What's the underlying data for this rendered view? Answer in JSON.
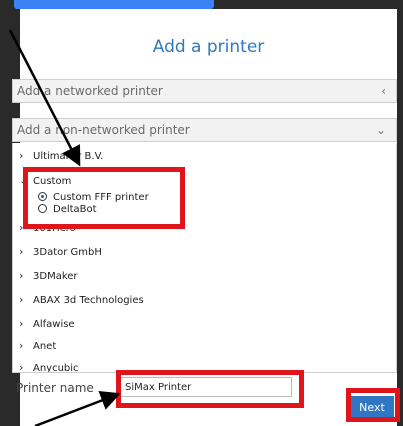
{
  "dialog": {
    "title": "Add a printer",
    "networked_label": "Add a networked printer",
    "nonnetworked_label": "Add a non-networked printer"
  },
  "icons": {
    "networked_chevron": "chevron-left-icon",
    "nonnetworked_chevron": "chevron-down-icon",
    "expand_arrow": "chevron-right-icon"
  },
  "manufacturers": [
    {
      "label": "Ultimaker B.V.",
      "expanded": false
    },
    {
      "label": "Custom",
      "expanded": true
    },
    {
      "label": "101Hero",
      "expanded": false
    },
    {
      "label": "3Dator GmbH",
      "expanded": false
    },
    {
      "label": "3DMaker",
      "expanded": false
    },
    {
      "label": "ABAX 3d Technologies",
      "expanded": false
    },
    {
      "label": "Alfawise",
      "expanded": false
    },
    {
      "label": "Anet",
      "expanded": false
    },
    {
      "label": "Anycubic",
      "expanded": false
    }
  ],
  "custom_printers": [
    {
      "label": "Custom FFF printer",
      "selected": true
    },
    {
      "label": "DeltaBot",
      "selected": false
    }
  ],
  "printer_name": {
    "label": "Printer name",
    "value": "SiMax Printer"
  },
  "next_button": "Next",
  "colors": {
    "accent": "#2f77c4",
    "annotation_red": "#e0141b",
    "background": "#2a2a2a"
  }
}
